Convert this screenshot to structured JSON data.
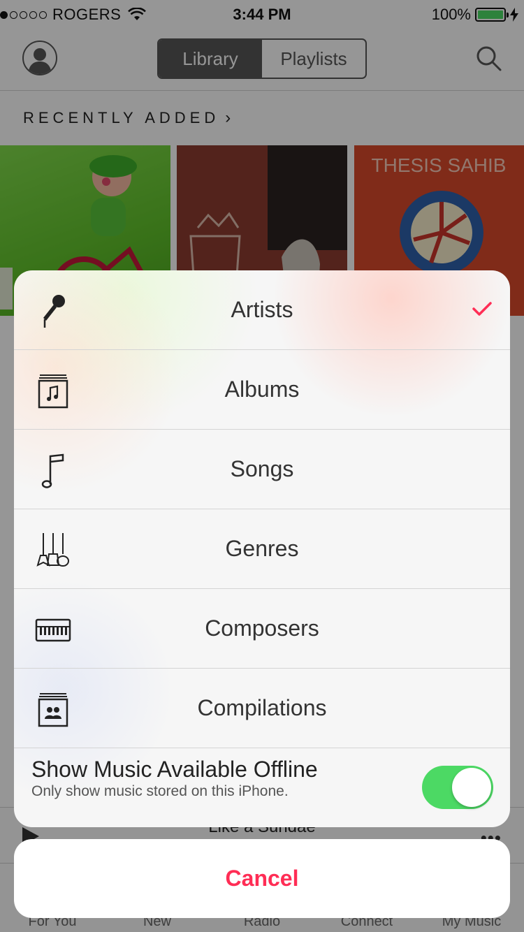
{
  "status_bar": {
    "carrier": "ROGERS",
    "time": "3:44 PM",
    "battery": "100%",
    "signal_bars_filled": 1,
    "signal_bars_total": 5
  },
  "nav": {
    "segments": [
      "Library",
      "Playlists"
    ],
    "selected_segment": "Library"
  },
  "recently_added": {
    "title": "RECENTLY ADDED",
    "chevron": "›",
    "album_cover_text": [
      "THESIS SAHIB"
    ]
  },
  "mini_player": {
    "title": "Like a Sundae",
    "more": "•••"
  },
  "tabbar": {
    "tabs": [
      "For You",
      "New",
      "Radio",
      "Connect",
      "My Music"
    ]
  },
  "sheet": {
    "items": [
      {
        "label": "Artists",
        "icon": "microphone-icon",
        "selected": true
      },
      {
        "label": "Albums",
        "icon": "album-stack-icon",
        "selected": false
      },
      {
        "label": "Songs",
        "icon": "music-note-icon",
        "selected": false
      },
      {
        "label": "Genres",
        "icon": "guitars-icon",
        "selected": false
      },
      {
        "label": "Composers",
        "icon": "piano-keyboard-icon",
        "selected": false
      },
      {
        "label": "Compilations",
        "icon": "compilation-icon",
        "selected": false
      }
    ],
    "offline": {
      "title": "Show Music Available Offline",
      "subtitle": "Only show music stored on this iPhone.",
      "enabled": true
    },
    "cancel_label": "Cancel"
  },
  "colors": {
    "accent": "#ff2d55",
    "toggle_on": "#4cd964",
    "battery": "#4cd964"
  }
}
